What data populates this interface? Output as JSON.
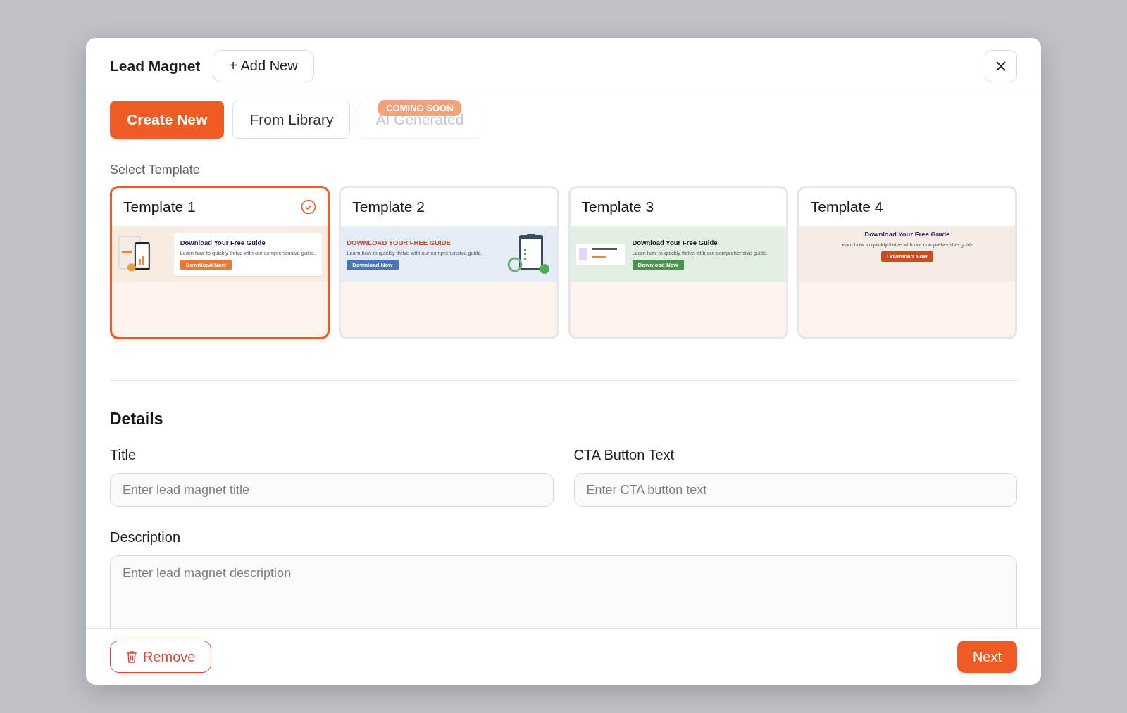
{
  "modal": {
    "title": "Lead Magnet",
    "add_button": "+ Add New"
  },
  "tabs": [
    {
      "label": "Create New",
      "selected": true,
      "disabled": false
    },
    {
      "label": "From Library",
      "selected": false,
      "disabled": false
    },
    {
      "label": "AI Generated",
      "selected": false,
      "disabled": true,
      "badge": "COMING SOON"
    }
  ],
  "section_label": "Select Template",
  "templates": [
    {
      "name": "Template 1",
      "selected": true,
      "kind": "book",
      "heading": "Download Your Free Guide",
      "text": "Learn how to quickly thrive with our comprehensive guide.",
      "button": "Download Now"
    },
    {
      "name": "Template 2",
      "selected": false,
      "kind": "clipboard",
      "heading": "DOWNLOAD YOUR FREE GUIDE",
      "text": "Learn how to quickly thrive with our comprehensive guide.",
      "button": "Download Now"
    },
    {
      "name": "Template 3",
      "selected": false,
      "kind": "thumbnail",
      "heading": "Download Your Free Guide",
      "text": "Learn how to quickly thrive with our comprehensive guide.",
      "button": "Download Now"
    },
    {
      "name": "Template 4",
      "selected": false,
      "kind": "centered",
      "heading": "Download Your Free Guide",
      "text": "Learn how to quickly thrive with our comprehensive guide.",
      "button": "Download Now"
    }
  ],
  "details": {
    "heading": "Details",
    "fields": [
      {
        "label": "Title",
        "placeholder": "Enter lead magnet title"
      },
      {
        "label": "CTA Button Text",
        "placeholder": "Enter CTA button text"
      }
    ],
    "description": {
      "label": "Description",
      "placeholder": "Enter lead magnet description"
    }
  },
  "footer": {
    "remove": "Remove",
    "next": "Next"
  }
}
